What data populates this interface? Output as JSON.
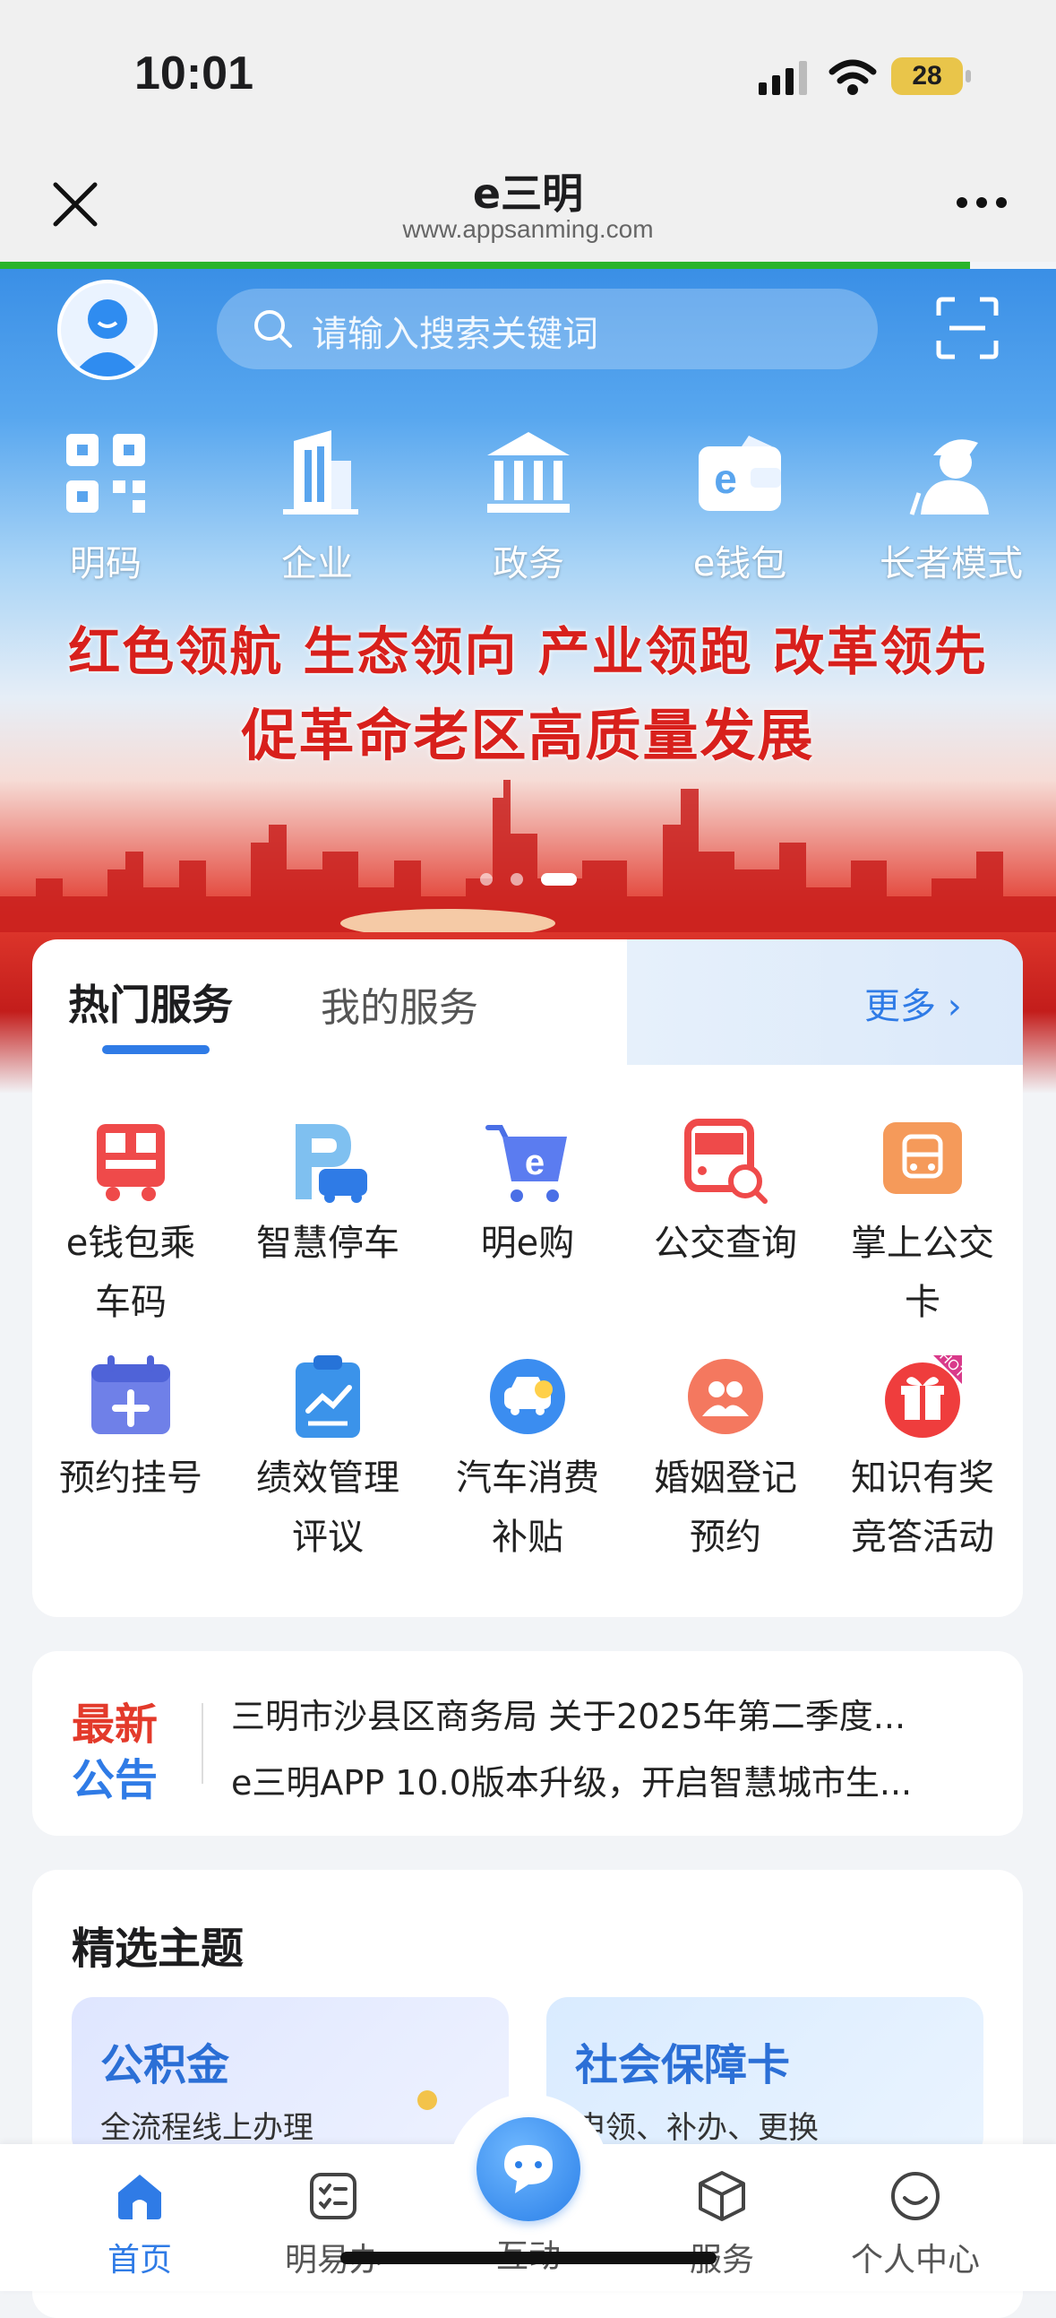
{
  "status_bar": {
    "time": "10:01",
    "battery": "28"
  },
  "nav": {
    "title": "e三明",
    "url": "www.appsanming.com"
  },
  "search": {
    "placeholder": "请输入搜索关键词"
  },
  "shortcuts": [
    {
      "label": "明码",
      "icon": "qr-code-icon"
    },
    {
      "label": "企业",
      "icon": "building-icon"
    },
    {
      "label": "政务",
      "icon": "government-icon"
    },
    {
      "label": "e钱包",
      "icon": "wallet-icon"
    },
    {
      "label": "长者模式",
      "icon": "elder-icon"
    }
  ],
  "banner": {
    "line1": "红色领航 生态领向 产业领跑 改革领先",
    "line2": "促革命老区高质量发展"
  },
  "services": {
    "tab_hot": "热门服务",
    "tab_my": "我的服务",
    "more": "更多 ›",
    "items": [
      {
        "label": "e钱包乘车码",
        "icon": "bus-qr-icon"
      },
      {
        "label": "智慧停车",
        "icon": "parking-icon"
      },
      {
        "label": "明e购",
        "icon": "shopping-cart-icon"
      },
      {
        "label": "公交查询",
        "icon": "bus-search-icon"
      },
      {
        "label": "掌上公交卡",
        "icon": "bus-card-icon"
      },
      {
        "label": "预约挂号",
        "icon": "calendar-plus-icon"
      },
      {
        "label": "绩效管理评议",
        "icon": "clipboard-chart-icon"
      },
      {
        "label": "汽车消费补贴",
        "icon": "car-subsidy-icon"
      },
      {
        "label": "婚姻登记预约",
        "icon": "marriage-icon"
      },
      {
        "label": "知识有奖竞答活动",
        "icon": "gift-icon",
        "badge": "HOT"
      }
    ]
  },
  "notice": {
    "tag_top": "最新",
    "tag_bottom": "公告",
    "lines": [
      "三明市沙县区商务局 关于2025年第二季度...",
      "e三明APP 10.0版本升级，开启智慧城市生..."
    ]
  },
  "featured": {
    "title": "精选主题",
    "topics": [
      {
        "title": "公积金",
        "subtitle": "全流程线上办理"
      },
      {
        "title": "社会保障卡",
        "subtitle": "申领、补办、更换"
      }
    ]
  },
  "tabbar": [
    {
      "label": "首页",
      "icon": "home-icon",
      "active": true
    },
    {
      "label": "明易办",
      "icon": "tasks-icon"
    },
    {
      "label": "互动",
      "icon": "chat-icon"
    },
    {
      "label": "服务",
      "icon": "cube-icon"
    },
    {
      "label": "个人中心",
      "icon": "smile-icon"
    }
  ]
}
